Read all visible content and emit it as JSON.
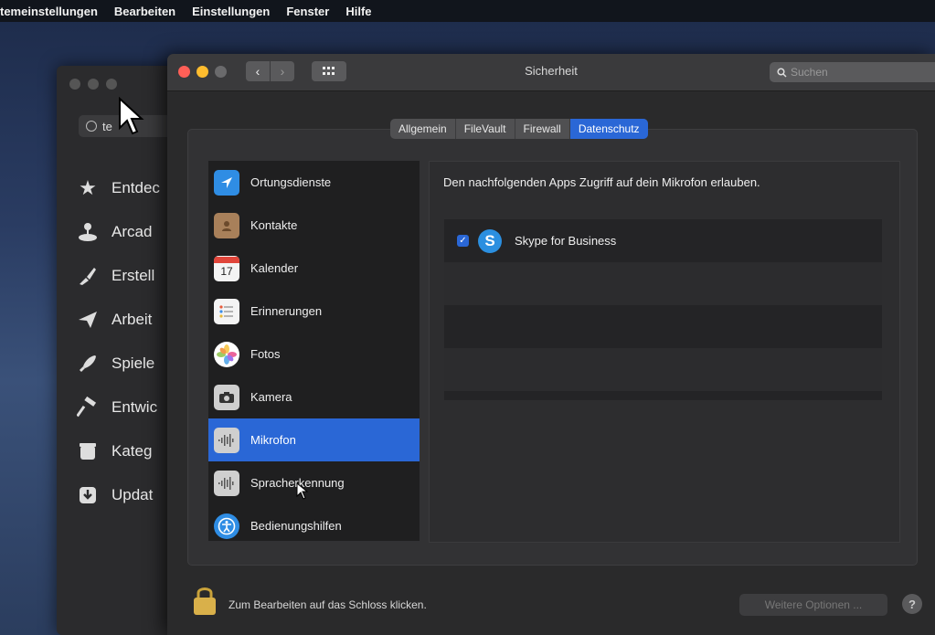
{
  "menubar": {
    "items": [
      "temeinstellungen",
      "Bearbeiten",
      "Einstellungen",
      "Fenster",
      "Hilfe"
    ]
  },
  "appstore": {
    "search_value": "te",
    "nav": [
      {
        "label": "Entdec",
        "icon": "star-icon"
      },
      {
        "label": "Arcad",
        "icon": "joystick-icon"
      },
      {
        "label": "Erstell",
        "icon": "brush-icon"
      },
      {
        "label": "Arbeit",
        "icon": "paperplane-icon"
      },
      {
        "label": "Spiele",
        "icon": "rocket-icon"
      },
      {
        "label": "Entwic",
        "icon": "hammer-icon"
      },
      {
        "label": "Kateg",
        "icon": "box-icon"
      },
      {
        "label": "Updat",
        "icon": "download-icon"
      }
    ]
  },
  "prefs": {
    "title": "Sicherheit",
    "search_placeholder": "Suchen",
    "tabs": [
      "Allgemein",
      "FileVault",
      "Firewall",
      "Datenschutz"
    ],
    "active_tab": "Datenschutz",
    "apps": [
      {
        "label": "Ortungsdienste",
        "icon": "location-arrow-icon"
      },
      {
        "label": "Kontakte",
        "icon": "contacts-book-icon"
      },
      {
        "label": "Kalender",
        "icon": "calendar-icon",
        "day": "17"
      },
      {
        "label": "Erinnerungen",
        "icon": "reminders-icon"
      },
      {
        "label": "Fotos",
        "icon": "photos-icon"
      },
      {
        "label": "Kamera",
        "icon": "camera-icon"
      },
      {
        "label": "Mikrofon",
        "icon": "microphone-waveform-icon"
      },
      {
        "label": "Spracherkennung",
        "icon": "speech-waveform-icon"
      },
      {
        "label": "Bedienungshilfen",
        "icon": "accessibility-icon"
      }
    ],
    "selected_app": "Mikrofon",
    "description": "Den nachfolgenden Apps Zugriff auf dein Mikrofon erlauben.",
    "allowed_apps": [
      {
        "name": "Skype for Business",
        "checked": true,
        "icon_letter": "S"
      }
    ],
    "lock_label": "Zum Bearbeiten auf das Schloss klicken.",
    "more_options": "Weitere Optionen ...",
    "help": "?"
  },
  "colors": {
    "accent": "#2a67d6",
    "close": "#ff5f57",
    "minimize": "#febc2e",
    "skype": "#2b8fe0"
  }
}
